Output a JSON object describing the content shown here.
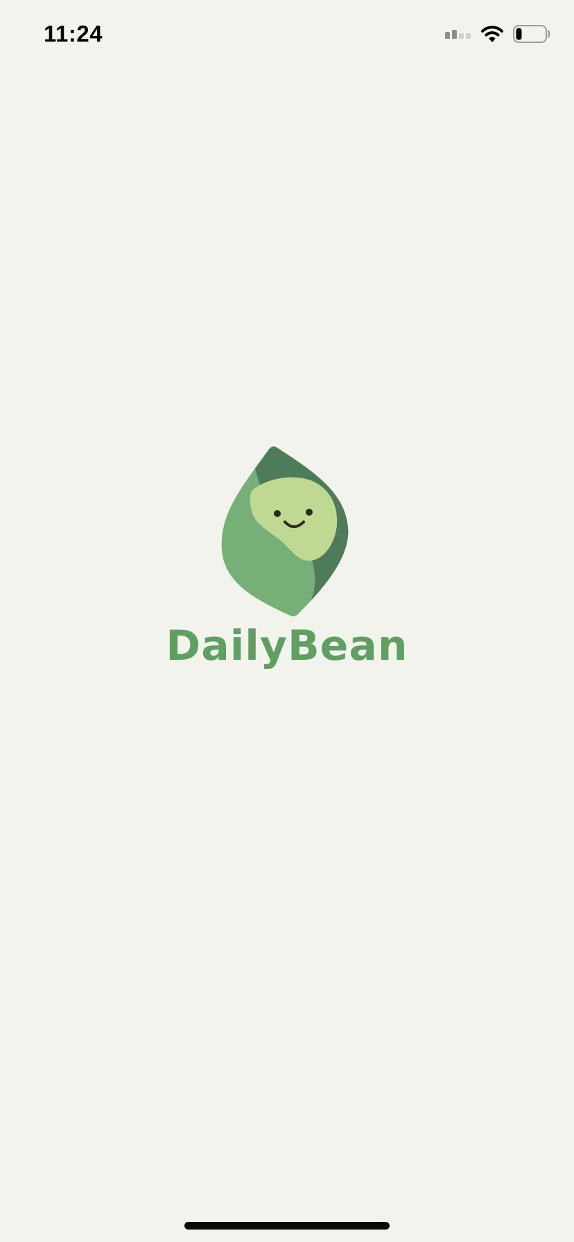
{
  "status_bar": {
    "time": "11:24",
    "icons": [
      "signal-icon",
      "wifi-icon",
      "battery-icon"
    ],
    "signal_bars_active": 2,
    "signal_bars_total": 4,
    "battery_level": 0.2
  },
  "splash": {
    "app_name": "DailyBean",
    "logo": "bean-mascot-logo"
  },
  "colors": {
    "background": "#F3F3EE",
    "brand_green": "#5FA062",
    "leaf_light": "#76AF77",
    "leaf_dark": "#4E7B59",
    "bean": "#C0D992",
    "face": "#2A2A22"
  }
}
